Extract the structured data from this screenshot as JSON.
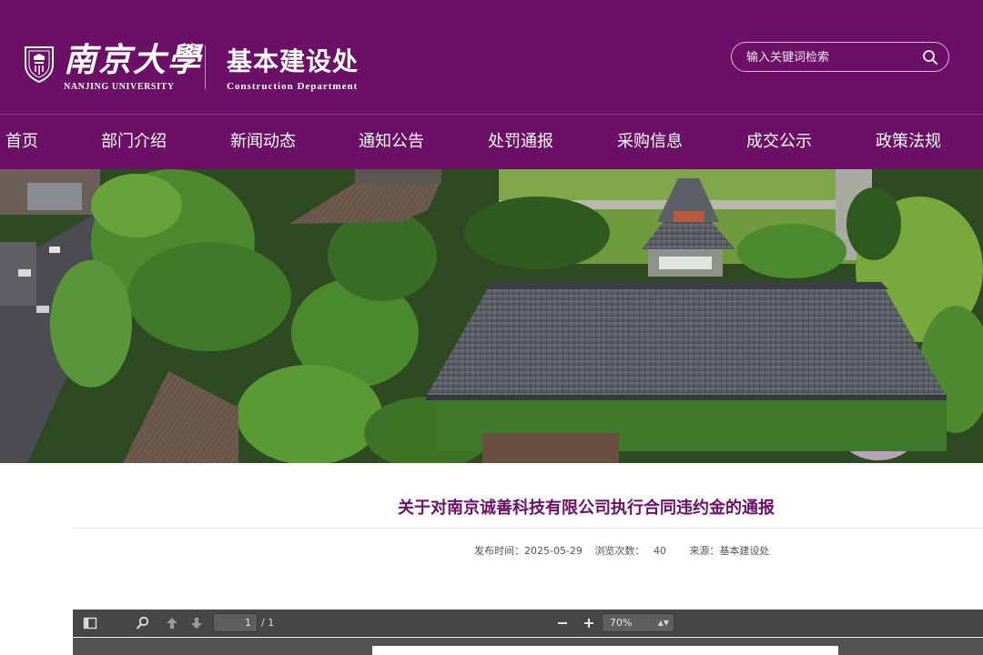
{
  "header": {
    "university_cn": "南京大學",
    "university_en": "NANJING UNIVERSITY",
    "department_cn": "基本建设处",
    "department_en": "Construction Department",
    "crest_icon": "university-crest-icon",
    "brand_color": "#6b1066"
  },
  "search": {
    "placeholder": "输入关键词检索",
    "icon": "search-icon"
  },
  "nav": {
    "items": [
      {
        "label": "首页"
      },
      {
        "label": "部门介绍"
      },
      {
        "label": "新闻动态"
      },
      {
        "label": "通知公告"
      },
      {
        "label": "处罚通报"
      },
      {
        "label": "采购信息"
      },
      {
        "label": "成交公示"
      },
      {
        "label": "政策法规"
      }
    ]
  },
  "banner": {
    "icon": "campus-aerial-photo"
  },
  "article": {
    "title": "关于对南京诚善科技有限公司执行合同违约金的通报",
    "publish_label": "发布时间：",
    "publish_date": "2025-05-29",
    "views_label": "浏览次数：",
    "views": "40",
    "source_label": "来源：",
    "source": "基本建设处",
    "title_color": "#6b1066"
  },
  "pdf_viewer": {
    "page_current": "1",
    "page_total": "/ 1",
    "zoom": "70%",
    "icons": [
      "sidebar-toggle-icon",
      "find-icon",
      "previous-page-icon",
      "next-page-icon",
      "zoom-out-icon",
      "zoom-in-icon"
    ]
  }
}
